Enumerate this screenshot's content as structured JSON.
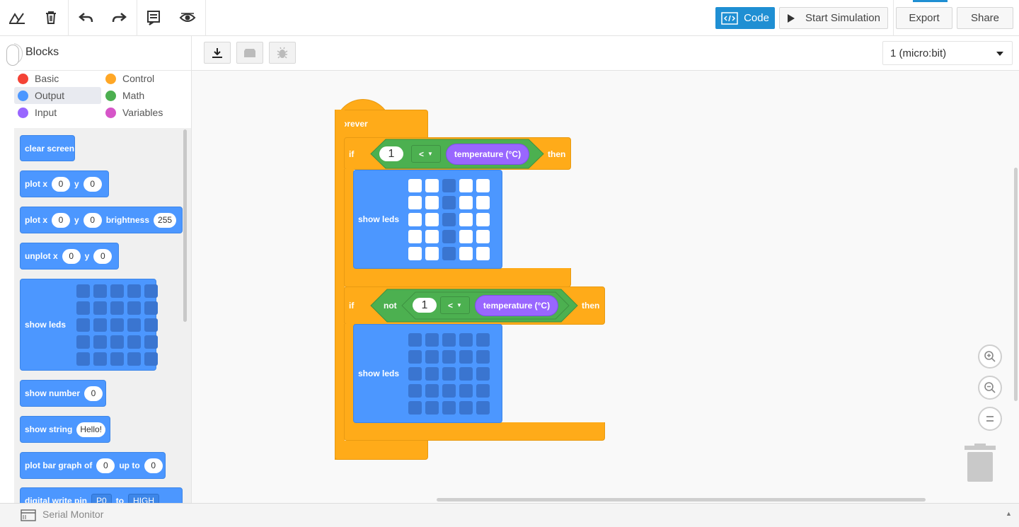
{
  "toolbar": {
    "code_label": "Code",
    "sim_label": "Start Simulation",
    "export_label": "Export",
    "share_label": "Share"
  },
  "device": {
    "selected": "1 (micro:bit)"
  },
  "sidebar": {
    "title": "Blocks",
    "categories": [
      {
        "label": "Basic",
        "color": "#f44336"
      },
      {
        "label": "Control",
        "color": "#ffa726"
      },
      {
        "label": "Output",
        "color": "#4c97ff"
      },
      {
        "label": "Math",
        "color": "#4caf50"
      },
      {
        "label": "Input",
        "color": "#9966ff"
      },
      {
        "label": "Variables",
        "color": "#d655c8"
      }
    ],
    "selected_category": "Output"
  },
  "palette": {
    "clear_screen": "clear screen",
    "plot": {
      "label": "plot x",
      "x": "0",
      "ylabel": "y",
      "y": "0"
    },
    "plot_bright": {
      "label": "plot x",
      "x": "0",
      "ylabel": "y",
      "y": "0",
      "blabel": "brightness",
      "b": "255"
    },
    "unplot": {
      "label": "unplot x",
      "x": "0",
      "ylabel": "y",
      "y": "0"
    },
    "show_leds": "show leds",
    "show_number": {
      "label": "show number",
      "value": "0"
    },
    "show_string": {
      "label": "show string",
      "value": "Hello!"
    },
    "bar_graph": {
      "label": "plot bar graph of",
      "value": "0",
      "up_to": "up to",
      "max": "0"
    },
    "digital_write": {
      "label": "digital write pin",
      "pin": "P0",
      "to": "to",
      "value": "HIGH"
    }
  },
  "workspace": {
    "forever": "forever",
    "if1": {
      "if": "if",
      "num": "1",
      "op": "<",
      "sensor": "temperature (°C)",
      "then": "then"
    },
    "leds1": {
      "label": "show leds",
      "grid": [
        [
          1,
          1,
          0,
          1,
          1
        ],
        [
          1,
          1,
          0,
          1,
          1
        ],
        [
          1,
          1,
          0,
          1,
          1
        ],
        [
          1,
          1,
          0,
          1,
          1
        ],
        [
          1,
          1,
          0,
          1,
          1
        ]
      ]
    },
    "if2": {
      "if": "if",
      "not": "not",
      "num": "1",
      "op": "<",
      "sensor": "temperature (°C)",
      "then": "then"
    },
    "leds2": {
      "label": "show leds",
      "grid": [
        [
          0,
          0,
          0,
          0,
          0
        ],
        [
          0,
          0,
          0,
          0,
          0
        ],
        [
          0,
          0,
          0,
          0,
          0
        ],
        [
          0,
          0,
          0,
          0,
          0
        ],
        [
          0,
          0,
          0,
          0,
          0
        ]
      ]
    }
  },
  "bottom": {
    "serial_monitor": "Serial Monitor"
  },
  "colors": {
    "event": "#ffab19",
    "logic": "#4cb050",
    "output": "#4c97ff",
    "sensor": "#9966ff",
    "accent": "#1f8fd3"
  }
}
